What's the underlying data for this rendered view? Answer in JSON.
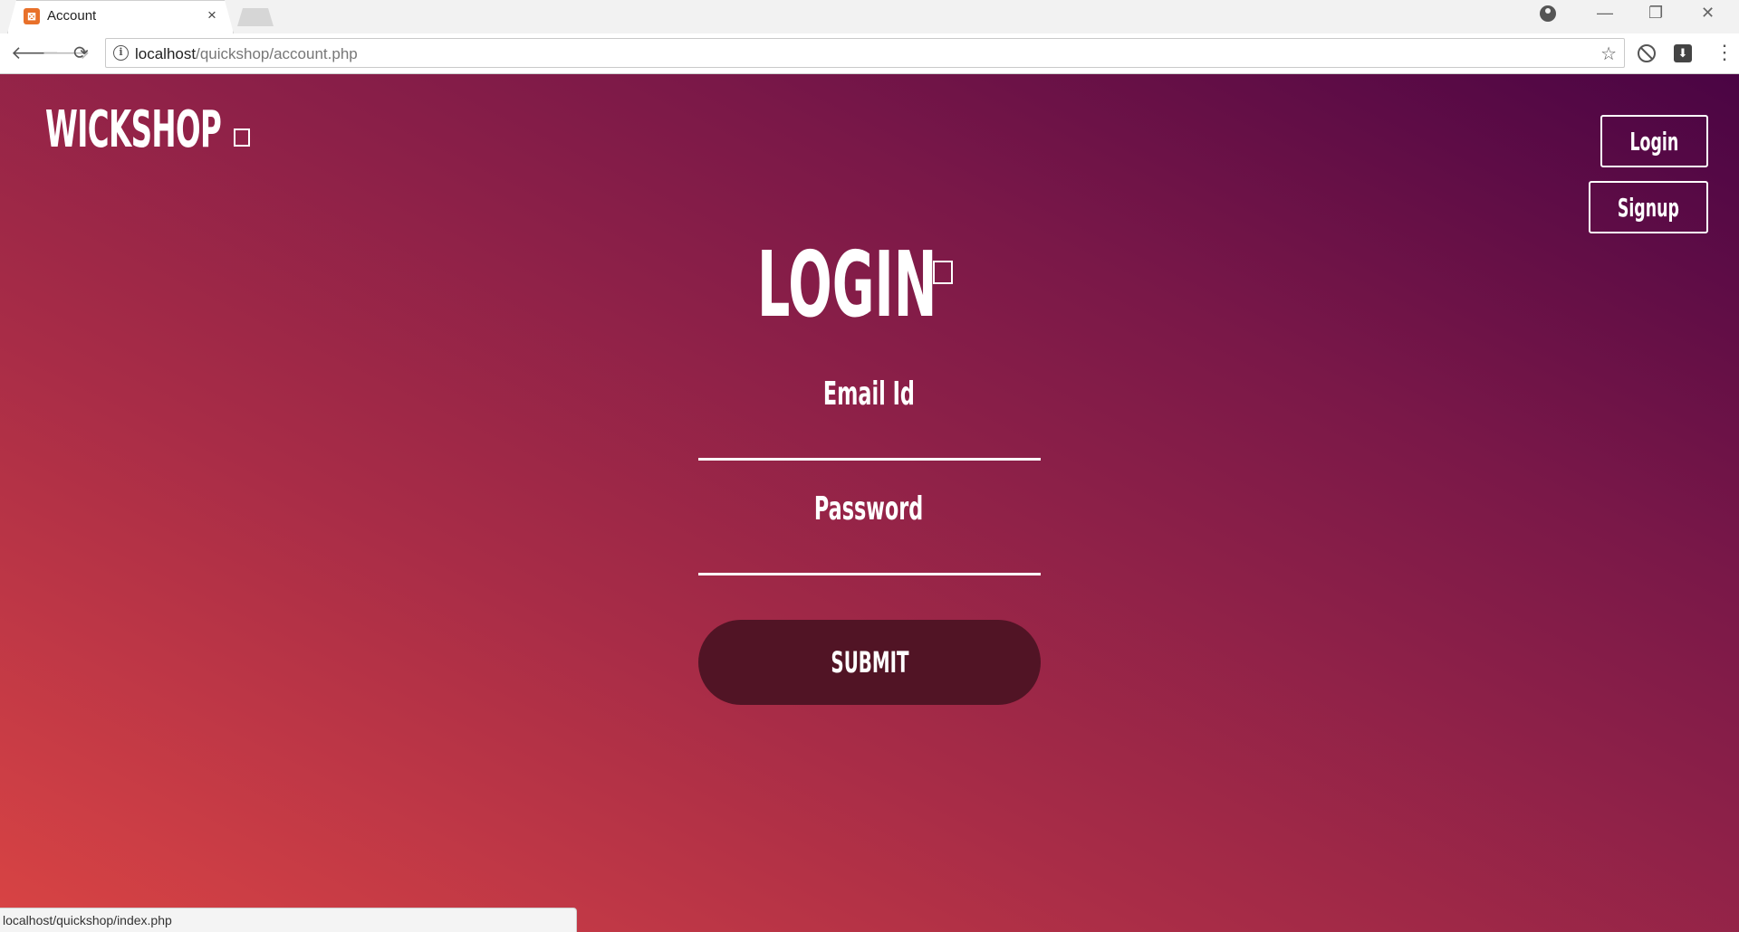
{
  "browser": {
    "tab_title": "Account",
    "favicon_glyph": "⊠",
    "tab_close": "×",
    "url_host": "localhost",
    "url_path": "/quickshop/account.php",
    "back_icon": "🡐",
    "forward_icon": "🡒",
    "reload_icon": "⟳",
    "star_icon": "☆",
    "menu_icon": "⋮",
    "minimize": "—",
    "restore": "❐",
    "close": "✕",
    "status_url": "localhost/quickshop/index.php"
  },
  "header": {
    "brand": "WICKSHOP",
    "login_label": "Login",
    "signup_label": "Signup"
  },
  "form": {
    "title": "LOGIN",
    "email_label": "Email Id",
    "email_value": "",
    "password_label": "Password",
    "password_value": "",
    "submit_label": "SUBMIT"
  },
  "colors": {
    "gradient_start": "#d94444",
    "gradient_end": "#4a0444",
    "submit_bg": "#511425"
  }
}
